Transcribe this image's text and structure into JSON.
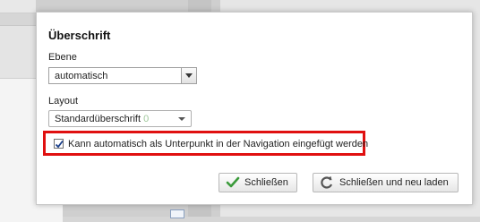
{
  "dialog": {
    "title": "Überschrift",
    "level": {
      "label": "Ebene",
      "value": "automatisch"
    },
    "layout": {
      "label": "Layout",
      "value": "Standardüberschrift",
      "hint": "0"
    },
    "subnav_option": {
      "label": "Kann automatisch als Unterpunkt in der Navigation eingefügt werden",
      "checked": true
    },
    "buttons": {
      "close": "Schließen",
      "close_reload": "Schließen und neu laden"
    }
  },
  "colors": {
    "highlight": "#e01010",
    "check_icon": "#3a9a3a",
    "reload_icon": "#555555"
  },
  "icons": {
    "close": "checkmark-icon",
    "reload": "refresh-icon",
    "dropdown": "chevron-down-icon"
  }
}
